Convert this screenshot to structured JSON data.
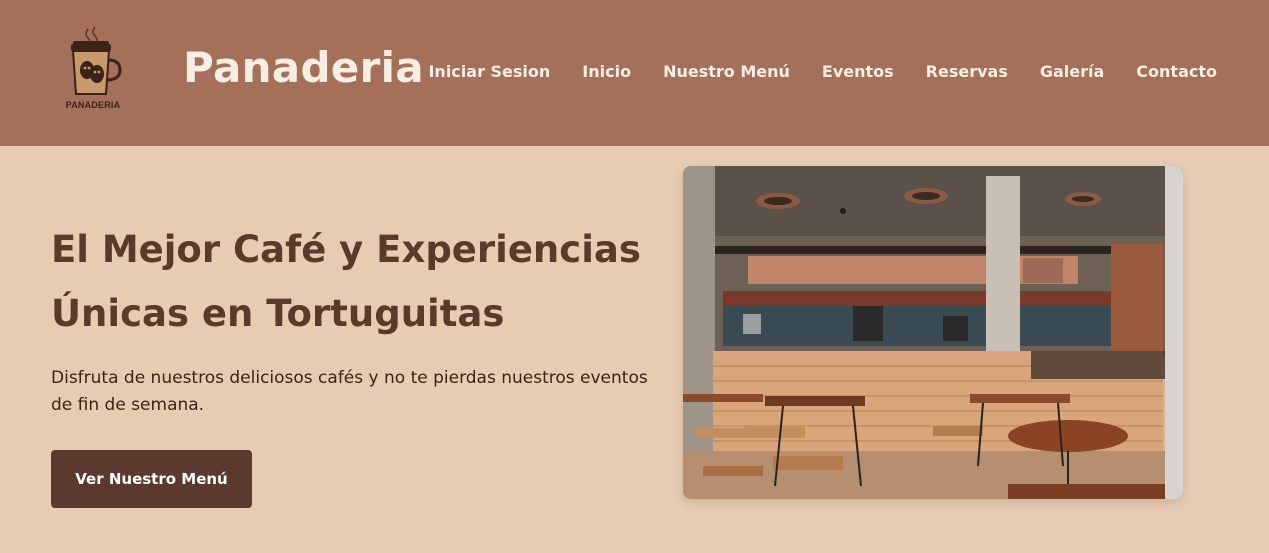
{
  "header": {
    "logo_text": "PANADERIA",
    "brand": "Panaderia",
    "nav": [
      {
        "label": "Iniciar Sesion"
      },
      {
        "label": "Inicio"
      },
      {
        "label": "Nuestro Menú"
      },
      {
        "label": "Eventos"
      },
      {
        "label": "Reservas"
      },
      {
        "label": "Galería"
      },
      {
        "label": "Contacto"
      }
    ]
  },
  "hero": {
    "title": "El Mejor Café y Experiencias Únicas en Tortuguitas",
    "description": "Disfruta de nuestros deliciosos cafés y no te pierdas nuestros eventos de fin de semana.",
    "cta_label": "Ver Nuestro Menú"
  },
  "colors": {
    "header_bg": "#a47059",
    "page_bg": "#e7ccb3",
    "accent_dark": "#5a3a2f",
    "title_color": "#5a3a2a"
  },
  "icons": {
    "logo": "coffee-cup-logo-icon"
  }
}
